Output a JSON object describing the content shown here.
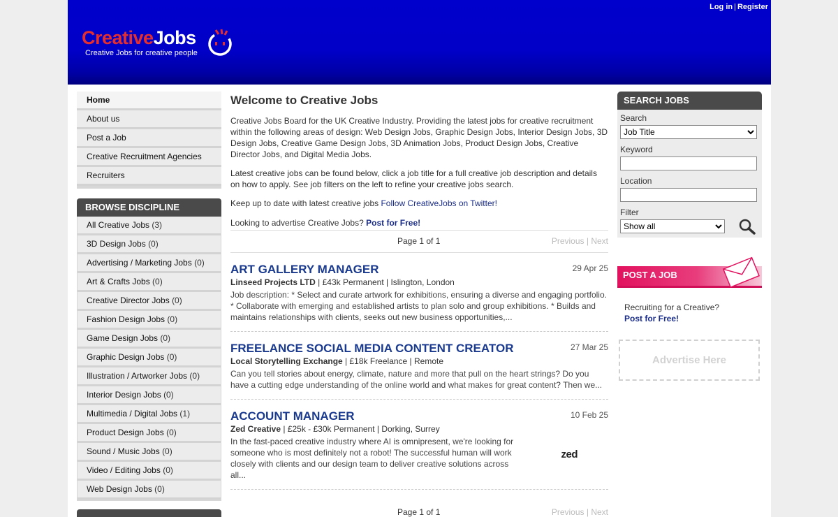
{
  "header": {
    "login_label": "Log in",
    "separator": "|",
    "register_label": "Register",
    "logo_word_1": "Creative",
    "logo_word_2": "Jobs",
    "logo_tagline": "Creative Jobs for creative people",
    "logo_mark_icon": "smiley-face-icon",
    "colors": {
      "brand_blue": "#0000cc",
      "logo_red": "#e52e2e"
    }
  },
  "nav": {
    "items": [
      {
        "label": "Home"
      },
      {
        "label": "About us"
      },
      {
        "label": "Post a Job"
      },
      {
        "label": "Creative Recruitment Agencies"
      },
      {
        "label": "Recruiters"
      }
    ]
  },
  "disciplines": {
    "heading": "BROWSE DISCIPLINE",
    "items": [
      {
        "label": "All Creative Jobs",
        "count": "(3)"
      },
      {
        "label": "3D Design Jobs",
        "count": "(0)"
      },
      {
        "label": "Advertising / Marketing Jobs",
        "count": "(0)"
      },
      {
        "label": "Art & Crafts Jobs",
        "count": "(0)"
      },
      {
        "label": "Creative Director Jobs",
        "count": "(0)"
      },
      {
        "label": "Fashion Design Jobs",
        "count": "(0)"
      },
      {
        "label": "Game Design Jobs",
        "count": "(0)"
      },
      {
        "label": "Graphic Design Jobs",
        "count": "(0)"
      },
      {
        "label": "Illustration / Artworker Jobs",
        "count": "(0)"
      },
      {
        "label": "Interior Design Jobs",
        "count": "(0)"
      },
      {
        "label": "Multimedia / Digital Jobs",
        "count": "(1)"
      },
      {
        "label": "Product Design Jobs",
        "count": "(0)"
      },
      {
        "label": "Sound / Music Jobs",
        "count": "(0)"
      },
      {
        "label": "Video / Editing Jobs",
        "count": "(0)"
      },
      {
        "label": "Web Design Jobs",
        "count": "(0)"
      }
    ]
  },
  "main": {
    "title": "Welcome to Creative Jobs",
    "intro": "Creative Jobs Board for the UK Creative Industry. Providing the latest jobs for creative recruitment within the following areas of design: Web Design Jobs, Graphic Design Jobs, Interior Design Jobs, 3D Design Jobs, Creative Game Design Jobs, 3D Animation Jobs, Product Design Jobs, Creative Director Jobs, and Digital Media Jobs.",
    "latest": "Latest creative jobs can be found below, click a job title for a full creative job description and details on how to apply. See job filters on the left to refine your creative jobs search.",
    "twitter_prefix": "Keep up to date with latest creative jobs ",
    "twitter_link": "Follow CreativeJobs on Twitter!",
    "advertise_prefix": "Looking to advertise Creative Jobs? ",
    "advertise_link": "Post for Free!",
    "pager": {
      "page_text": "Page 1 of 1",
      "previous": "Previous",
      "separator": "|",
      "next": "Next"
    }
  },
  "jobs": [
    {
      "title": "ART GALLERY MANAGER",
      "date": "29 Apr 25",
      "company": "Linseed Projects LTD",
      "details": " | £43k Permanent | Islington, London",
      "description": "Job description:  * Select and curate artwork for exhibitions, ensuring a diverse and engaging portfolio. * Collaborate with emerging and established artists to plan solo and group exhibitions. * Builds and maintains relationships with clients, seeks out new business opportunities,..."
    },
    {
      "title": "FREELANCE SOCIAL MEDIA CONTENT CREATOR",
      "date": "27 Mar 25",
      "company": "Local Storytelling Exchange",
      "details": " | £18k Freelance | Remote",
      "description": "Can you tell stories about energy, climate, nature and more that pull on the heart strings? Do you have a cutting edge understanding of the online world and what makes for great content? Then we..."
    },
    {
      "title": "ACCOUNT MANAGER",
      "date": "10 Feb 25",
      "company": "Zed Creative",
      "details": " | £25k - £30k Permanent | Dorking, Surrey",
      "description": "In the fast-paced creative industry where AI is omnipresent, we're looking for someone who is most definitely not a robot! The successful human will work closely with clients and our design team to deliver creative solutions across all...",
      "logo_text": "zed"
    }
  ],
  "search": {
    "heading": "SEARCH JOBS",
    "search_label": "Search",
    "search_selected": "Job Title",
    "keyword_label": "Keyword",
    "keyword_value": "",
    "location_label": "Location",
    "location_value": "",
    "filter_label": "Filter",
    "filter_selected": "Show all",
    "go_icon": "magnifier-icon"
  },
  "post_job": {
    "heading": "POST A JOB",
    "envelope_icon": "envelope-icon",
    "line1": "Recruiting for a Creative?",
    "link": "Post for Free!"
  },
  "advert": {
    "label": "Advertise Here"
  }
}
